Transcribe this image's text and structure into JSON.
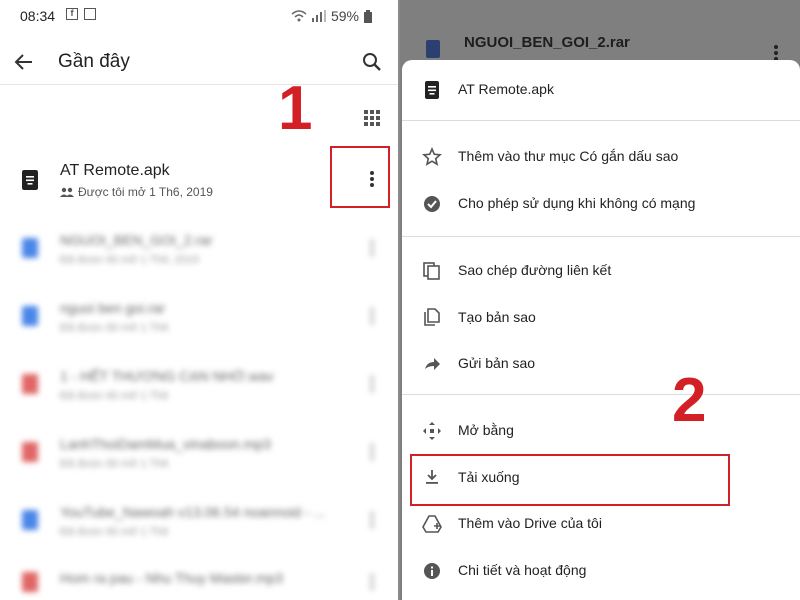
{
  "status": {
    "time": "08:34",
    "fb_label": "f",
    "signal_text": "59%"
  },
  "left": {
    "title": "Gần đây",
    "primary_file": {
      "name": "AT Remote.apk",
      "meta": "Được tôi mở 1 Th6, 2019"
    },
    "blurred_files": [
      {
        "name": "NGUOI_BEN_GOI_2.rar",
        "meta": "Đã được tôi mở 1 Th6, 2019",
        "color": "#4a86e8"
      },
      {
        "name": "nguoi ben goi.rar",
        "meta": "Đã được tôi mở 1 Th6",
        "color": "#4a86e8"
      },
      {
        "name": "1 - HẾT THƯƠNG CẠN NHỚ.wav",
        "meta": "Đã được tôi mở 1 Th6",
        "color": "#e06666"
      },
      {
        "name": "LanhThoiDamMua_vinaboon.mp3",
        "meta": "Đã được tôi mở 1 Th6",
        "color": "#e06666"
      },
      {
        "name": "YouTube_Nawoah v13.06.54 noannoid - ...",
        "meta": "Đã được tôi mở 1 Th6",
        "color": "#4a86e8"
      },
      {
        "name": "Hom ra pau - Nhu Thuy Master.mp3",
        "meta": "Đã được tôi mở 1 Th6",
        "color": "#e06666"
      }
    ],
    "step_label": "1"
  },
  "right": {
    "background_file": "NGUOI_BEN_GOI_2.rar",
    "sheet_header": "AT Remote.apk",
    "menu": [
      {
        "label": "Thêm vào thư mục Có gắn dấu sao",
        "icon": "star-outline-icon"
      },
      {
        "label": "Cho phép sử dụng khi không có mạng",
        "icon": "offline-check-icon"
      },
      {
        "label": "Sao chép đường liên kết",
        "icon": "copy-link-icon"
      },
      {
        "label": "Tạo bản sao",
        "icon": "duplicate-icon"
      },
      {
        "label": "Gửi bản sao",
        "icon": "send-copy-icon"
      },
      {
        "label": "Mở bằng",
        "icon": "open-with-icon"
      },
      {
        "label": "Tải xuống",
        "icon": "download-icon"
      },
      {
        "label": "Thêm vào Drive của tôi",
        "icon": "add-to-drive-icon"
      },
      {
        "label": "Chi tiết và hoạt động",
        "icon": "info-icon"
      }
    ],
    "step_label": "2"
  },
  "colors": {
    "highlight": "#d32026",
    "dim_overlay": "#7f7f7f"
  }
}
